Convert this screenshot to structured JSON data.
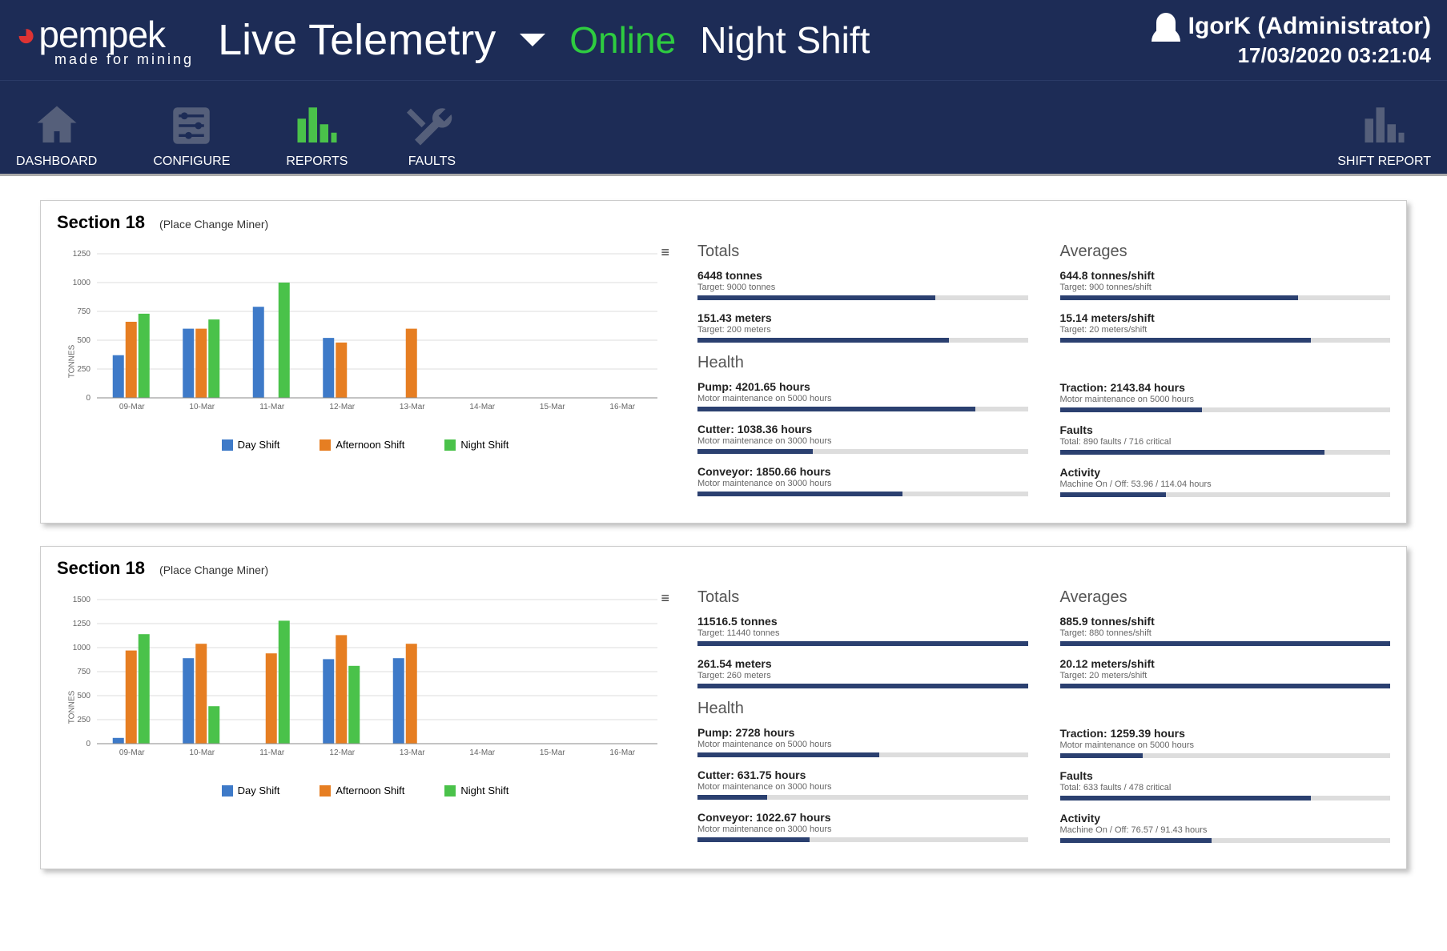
{
  "header": {
    "logo_text": "pempek",
    "logo_tagline": "made for mining",
    "page_title": "Live Telemetry",
    "status": "Online",
    "shift": "Night Shift",
    "user": "IgorK (Administrator)",
    "datetime": "17/03/2020 03:21:04"
  },
  "nav": {
    "items": [
      {
        "label": "DASHBOARD",
        "key": "dashboard"
      },
      {
        "label": "CONFIGURE",
        "key": "configure"
      },
      {
        "label": "REPORTS",
        "key": "reports",
        "active": true
      },
      {
        "label": "FAULTS",
        "key": "faults"
      }
    ],
    "right": {
      "label": "SHIFT REPORT",
      "key": "shift-report"
    }
  },
  "panels": [
    {
      "title": "Section 18",
      "subtitle": "(Place Change Miner)",
      "chart_index": 0,
      "totals_heading": "Totals",
      "averages_heading": "Averages",
      "health_heading": "Health",
      "totals": [
        {
          "title": "6448 tonnes",
          "sub": "Target: 9000 tonnes",
          "pct": 72
        },
        {
          "title": "151.43 meters",
          "sub": "Target: 200 meters",
          "pct": 76
        }
      ],
      "averages": [
        {
          "title": "644.8 tonnes/shift",
          "sub": "Target: 900 tonnes/shift",
          "pct": 72
        },
        {
          "title": "15.14 meters/shift",
          "sub": "Target: 20 meters/shift",
          "pct": 76
        }
      ],
      "health_left": [
        {
          "title": "Pump: 4201.65 hours",
          "sub": "Motor maintenance on 5000 hours",
          "pct": 84
        },
        {
          "title": "Cutter: 1038.36 hours",
          "sub": "Motor maintenance on 3000 hours",
          "pct": 35
        },
        {
          "title": "Conveyor: 1850.66 hours",
          "sub": "Motor maintenance on 3000 hours",
          "pct": 62
        }
      ],
      "health_right": [
        {
          "title": "Traction: 2143.84 hours",
          "sub": "Motor maintenance on 5000 hours",
          "pct": 43
        },
        {
          "title": "Faults",
          "sub": "Total: 890 faults / 716 critical",
          "pct": 80
        },
        {
          "title": "Activity",
          "sub": "Machine On / Off: 53.96 / 114.04 hours",
          "pct": 32
        }
      ]
    },
    {
      "title": "Section 18",
      "subtitle": "(Place Change Miner)",
      "chart_index": 1,
      "totals_heading": "Totals",
      "averages_heading": "Averages",
      "health_heading": "Health",
      "totals": [
        {
          "title": "11516.5 tonnes",
          "sub": "Target: 11440 tonnes",
          "pct": 100
        },
        {
          "title": "261.54 meters",
          "sub": "Target: 260 meters",
          "pct": 100
        }
      ],
      "averages": [
        {
          "title": "885.9 tonnes/shift",
          "sub": "Target: 880 tonnes/shift",
          "pct": 100
        },
        {
          "title": "20.12 meters/shift",
          "sub": "Target: 20 meters/shift",
          "pct": 100
        }
      ],
      "health_left": [
        {
          "title": "Pump: 2728 hours",
          "sub": "Motor maintenance on 5000 hours",
          "pct": 55
        },
        {
          "title": "Cutter: 631.75 hours",
          "sub": "Motor maintenance on 3000 hours",
          "pct": 21
        },
        {
          "title": "Conveyor: 1022.67 hours",
          "sub": "Motor maintenance on 3000 hours",
          "pct": 34
        }
      ],
      "health_right": [
        {
          "title": "Traction: 1259.39 hours",
          "sub": "Motor maintenance on 5000 hours",
          "pct": 25
        },
        {
          "title": "Faults",
          "sub": "Total: 633 faults / 478 critical",
          "pct": 76
        },
        {
          "title": "Activity",
          "sub": "Machine On / Off: 76.57 / 91.43 hours",
          "pct": 46
        }
      ]
    }
  ],
  "legend": {
    "day": "Day Shift",
    "afternoon": "Afternoon Shift",
    "night": "Night Shift"
  },
  "chart_data": [
    {
      "type": "bar",
      "title": "",
      "xlabel": "",
      "ylabel": "TONNES",
      "ylim": [
        0,
        1250
      ],
      "yticks": [
        0,
        250,
        500,
        750,
        1000,
        1250
      ],
      "categories": [
        "09-Mar",
        "10-Mar",
        "11-Mar",
        "12-Mar",
        "13-Mar",
        "14-Mar",
        "15-Mar",
        "16-Mar"
      ],
      "series": [
        {
          "name": "Day Shift",
          "color": "#3e7ac8",
          "values": [
            370,
            600,
            790,
            520,
            0,
            0,
            0,
            0
          ]
        },
        {
          "name": "Afternoon Shift",
          "color": "#e67e22",
          "values": [
            660,
            600,
            0,
            480,
            600,
            0,
            0,
            0
          ]
        },
        {
          "name": "Night Shift",
          "color": "#4ac24a",
          "values": [
            730,
            680,
            1000,
            0,
            0,
            0,
            0,
            0
          ]
        }
      ]
    },
    {
      "type": "bar",
      "title": "",
      "xlabel": "",
      "ylabel": "TONNES",
      "ylim": [
        0,
        1500
      ],
      "yticks": [
        0,
        250,
        500,
        750,
        1000,
        1250,
        1500
      ],
      "categories": [
        "09-Mar",
        "10-Mar",
        "11-Mar",
        "12-Mar",
        "13-Mar",
        "14-Mar",
        "15-Mar",
        "16-Mar"
      ],
      "series": [
        {
          "name": "Day Shift",
          "color": "#3e7ac8",
          "values": [
            60,
            890,
            0,
            880,
            890,
            0,
            0,
            0
          ]
        },
        {
          "name": "Afternoon Shift",
          "color": "#e67e22",
          "values": [
            970,
            1040,
            940,
            1130,
            1040,
            0,
            0,
            0
          ]
        },
        {
          "name": "Night Shift",
          "color": "#4ac24a",
          "values": [
            1140,
            390,
            1280,
            810,
            0,
            0,
            0,
            0
          ]
        }
      ]
    }
  ]
}
